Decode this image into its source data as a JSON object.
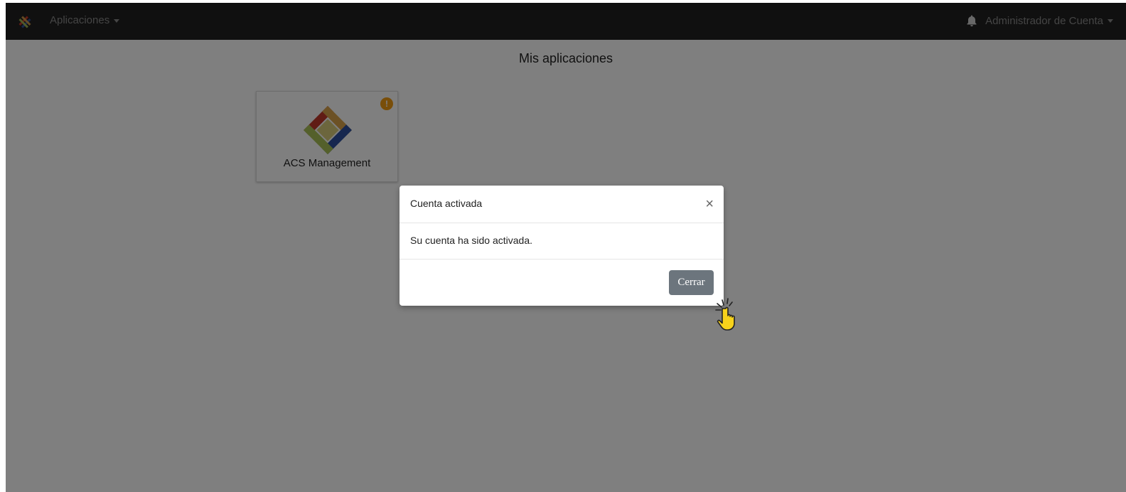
{
  "navbar": {
    "apps_menu_label": "Aplicaciones",
    "account_label": "Administrador de Cuenta",
    "icons": {
      "brand": "brand-logo-icon",
      "bell": "bell-icon",
      "caret": "caret-down-icon"
    }
  },
  "main": {
    "title": "Mis aplicaciones",
    "apps": [
      {
        "name": "ACS Management",
        "badge": "!",
        "badge_color": "#f39c12"
      }
    ]
  },
  "modal": {
    "title": "Cuenta activada",
    "close_symbol": "×",
    "message": "Su cuenta ha sido activada.",
    "button_label": "Cerrar",
    "button_color": "#6c757d"
  },
  "colors": {
    "navbar_bg": "#212121",
    "backdrop": "rgba(0,0,0,0.5)",
    "logo_red": "#c0392b",
    "logo_orange": "#d9a24a",
    "logo_green": "#a9c056",
    "logo_blue": "#2c4f9e",
    "logo_center": "#d8cc7a"
  }
}
